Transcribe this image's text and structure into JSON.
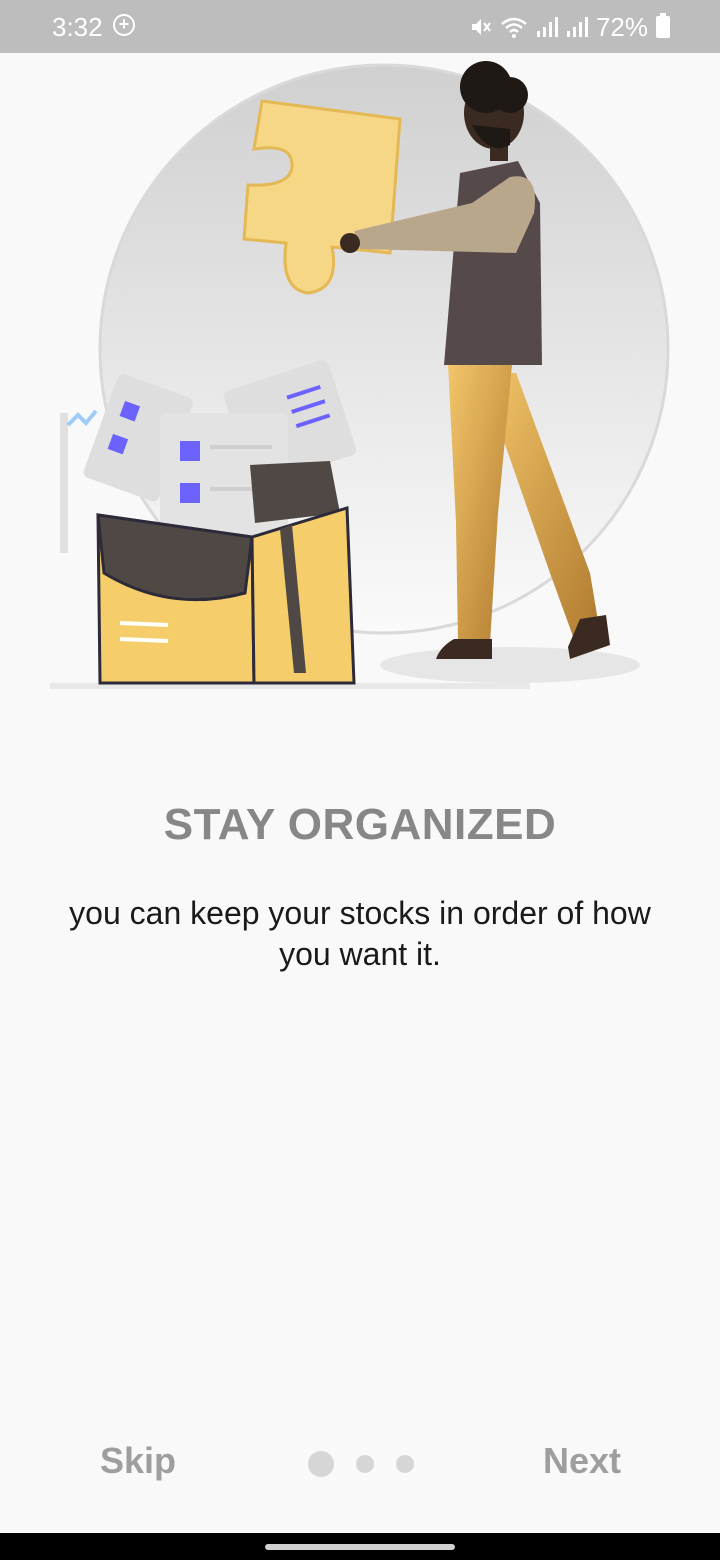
{
  "status_bar": {
    "time": "3:32",
    "battery_percent": "72%",
    "icons": [
      "add-circle-icon",
      "mute-icon",
      "wifi-icon",
      "signal-icon",
      "signal-icon",
      "battery-icon"
    ]
  },
  "onboarding": {
    "title": "STAY ORGANIZED",
    "description": "you can keep your stocks in order of how you want it.",
    "current_page": 1,
    "total_pages": 3
  },
  "nav": {
    "skip_label": "Skip",
    "next_label": "Next"
  },
  "colors": {
    "background": "#f9f9f9",
    "status_bar": "#bdbdbd",
    "title": "#878787",
    "button_text": "#9e9e9e",
    "dot": "#d6d6d6",
    "accent_yellow": "#f5cd6a",
    "accent_purple": "#6c63ff"
  }
}
